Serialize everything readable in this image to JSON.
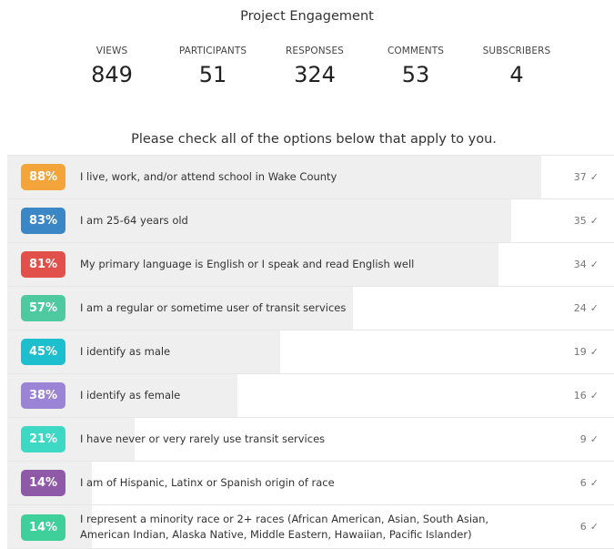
{
  "header": {
    "title": "Project Engagement"
  },
  "stats": [
    {
      "label": "VIEWS",
      "value": "849"
    },
    {
      "label": "PARTICIPANTS",
      "value": "51"
    },
    {
      "label": "RESPONSES",
      "value": "324"
    },
    {
      "label": "COMMENTS",
      "value": "53"
    },
    {
      "label": "SUBSCRIBERS",
      "value": "4"
    }
  ],
  "question": "Please check all of the options below that apply to you.",
  "check_icon": "checkmark-icon",
  "options": [
    {
      "percent_label": "88%",
      "percent": 88,
      "text": "I live, work, and/or attend school in Wake County",
      "count": "37",
      "color": "#f3a53b"
    },
    {
      "percent_label": "83%",
      "percent": 83,
      "text": "I am 25-64 years old",
      "count": "35",
      "color": "#3b86c4"
    },
    {
      "percent_label": "81%",
      "percent": 81,
      "text": "My primary language is English or I speak and read English well",
      "count": "34",
      "color": "#e2504b"
    },
    {
      "percent_label": "57%",
      "percent": 57,
      "text": "I am a regular or sometime user of transit services",
      "count": "24",
      "color": "#4fc9a0"
    },
    {
      "percent_label": "45%",
      "percent": 45,
      "text": "I identify as male",
      "count": "19",
      "color": "#1bbfcd"
    },
    {
      "percent_label": "38%",
      "percent": 38,
      "text": "I identify as female",
      "count": "16",
      "color": "#9b83d6"
    },
    {
      "percent_label": "21%",
      "percent": 21,
      "text": "I have never or very rarely use transit services",
      "count": "9",
      "color": "#3ed9c4"
    },
    {
      "percent_label": "14%",
      "percent": 14,
      "text": "I am of Hispanic, Latinx or Spanish origin of race",
      "count": "6",
      "color": "#8e5aa8"
    },
    {
      "percent_label": "14%",
      "percent": 14,
      "text": "I represent a minority race or 2+ races (African American, Asian, South Asian, American Indian, Alaska Native, Middle Eastern, Hawaiian, Pacific Islander)",
      "count": "6",
      "color": "#3fcf9b"
    }
  ]
}
